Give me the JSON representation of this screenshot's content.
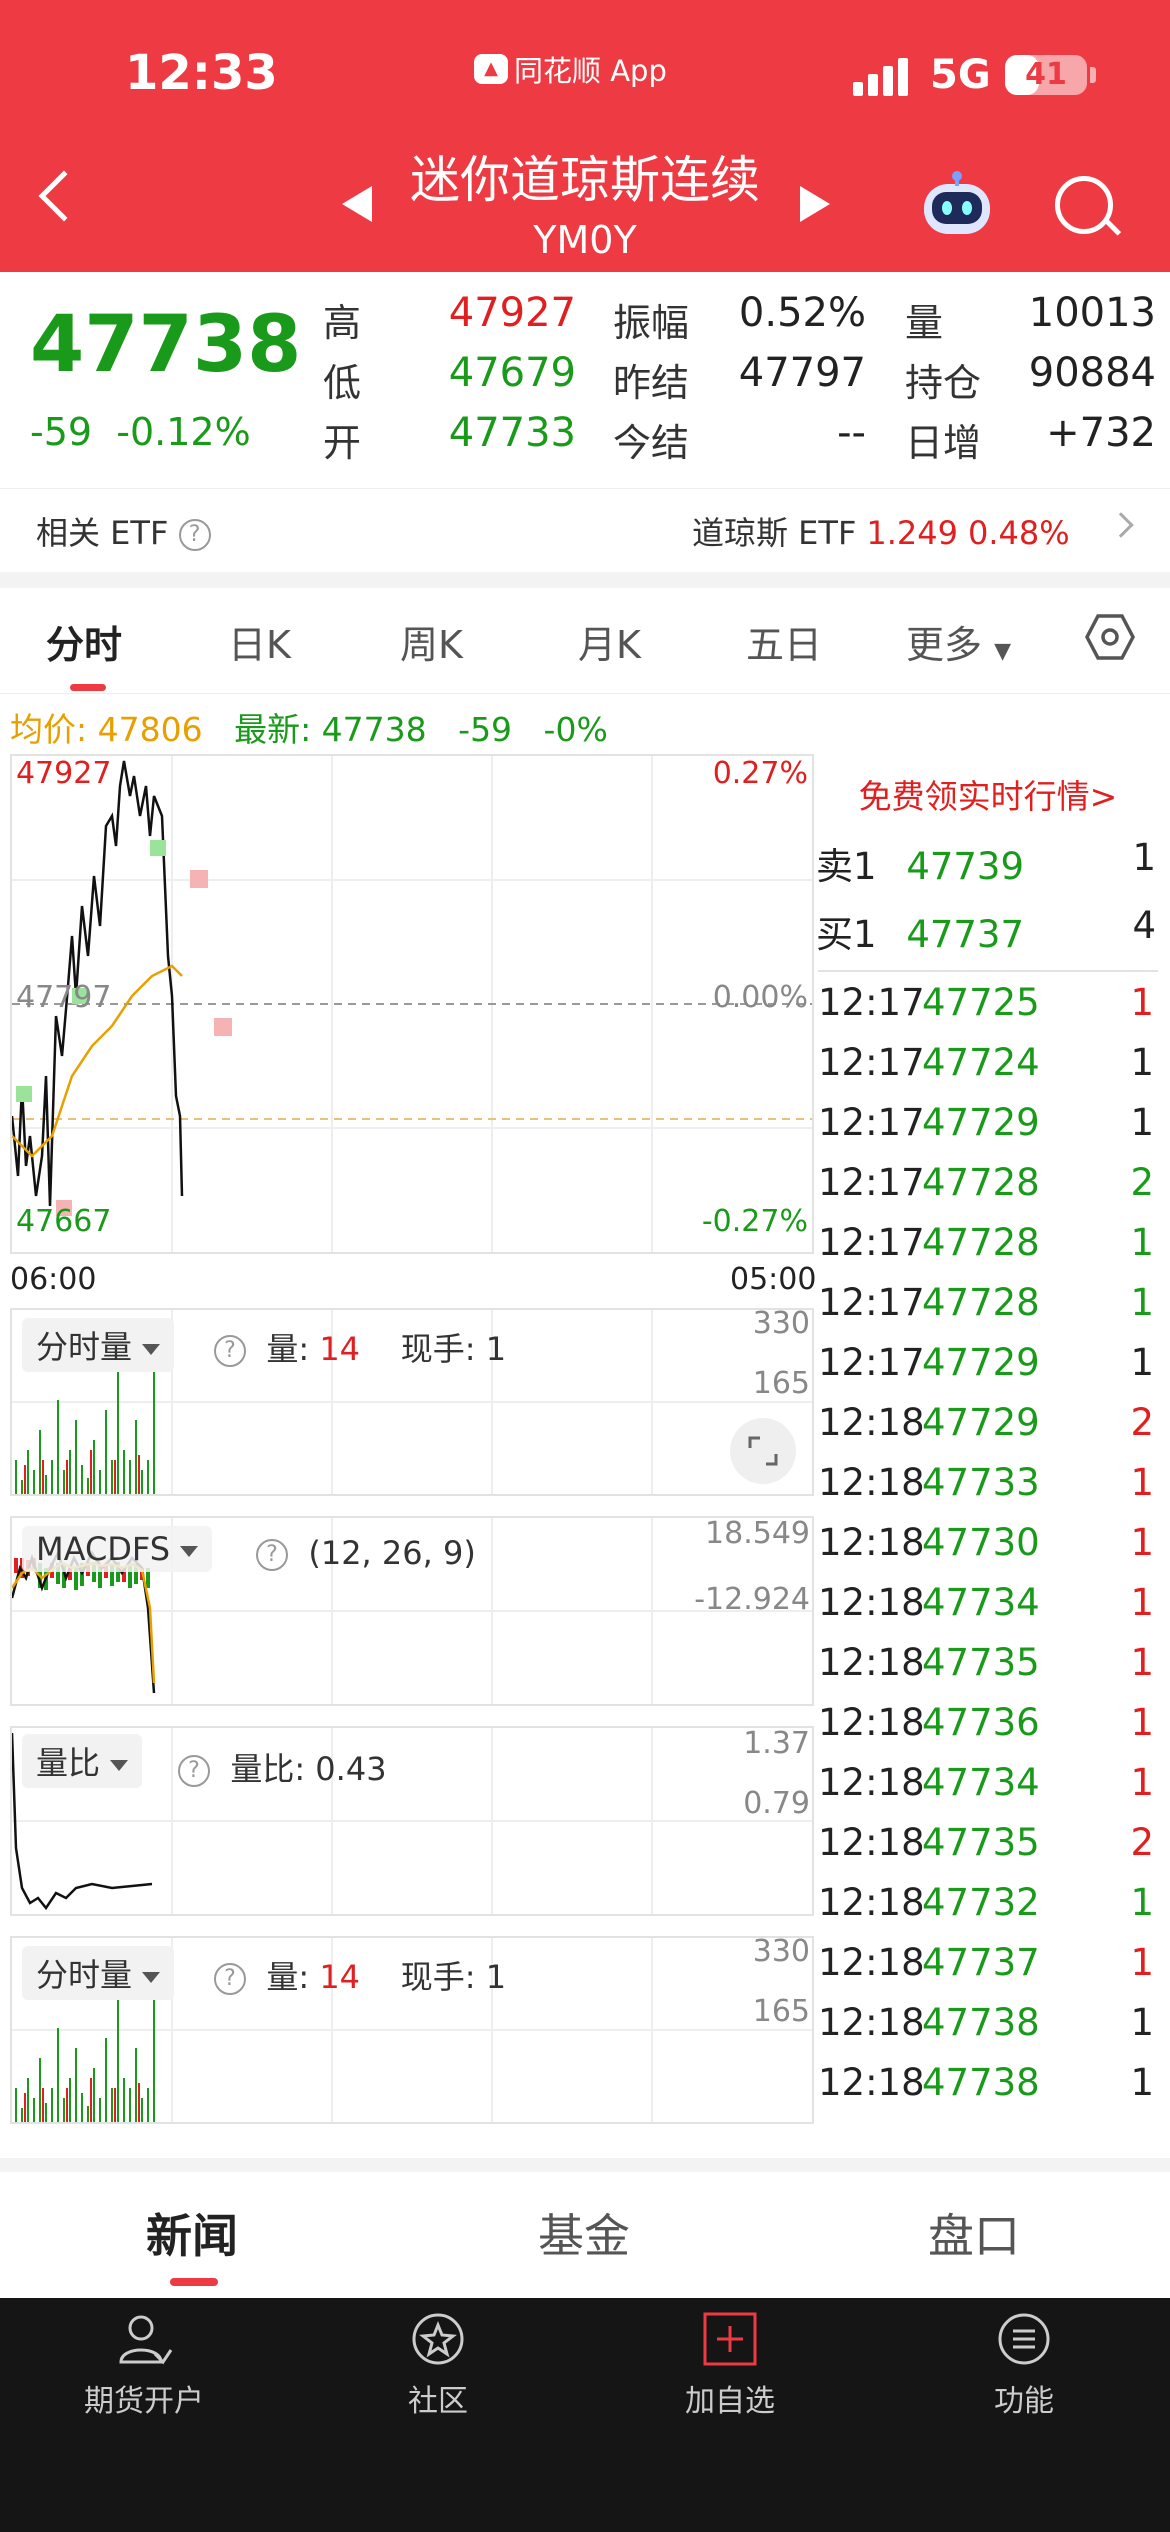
{
  "status_bar": {
    "time": "12:33",
    "app_name": "同花顺 App",
    "network": "5G",
    "battery": "41",
    "battery_level": 0.41
  },
  "header": {
    "title": "迷你道琼斯连续",
    "symbol": "YM0Y"
  },
  "quote": {
    "last_price": "47738",
    "change": "-59",
    "change_pct": "-0.12%",
    "high_label": "高",
    "high": "47927",
    "low_label": "低",
    "low": "47679",
    "open_label": "开",
    "open": "47733",
    "amplitude_label": "振幅",
    "amplitude": "0.52%",
    "prev_settle_label": "昨结",
    "prev_settle": "47797",
    "today_settle_label": "今结",
    "today_settle": "--",
    "volume_label": "量",
    "volume": "10013",
    "open_interest_label": "持仓",
    "open_interest": "90884",
    "daily_change_label": "日增",
    "daily_change": "+732"
  },
  "etf": {
    "label": "相关 ETF",
    "name": "道琼斯 ETF",
    "price": "1.249",
    "pct": "0.48%"
  },
  "tabs": [
    "分时",
    "日K",
    "周K",
    "月K",
    "五日",
    "更多"
  ],
  "intraday": {
    "avg_label": "均价: 47806",
    "latest_label": "最新: 47738",
    "latest_change": "-59",
    "latest_pct": "-0%",
    "y_top": "47927",
    "y_mid": "47797",
    "y_bottom": "47667",
    "pct_top": "0.27%",
    "pct_mid": "0.00%",
    "pct_bottom": "-0.27%",
    "x_start": "06:00",
    "x_end": "05:00"
  },
  "order_book": {
    "promo": "免费领实时行情>",
    "sell1_label": "卖1",
    "sell1_price": "47739",
    "sell1_vol": "1",
    "buy1_label": "买1",
    "buy1_price": "47737",
    "buy1_vol": "4"
  },
  "trades": [
    {
      "t": "12:17",
      "p": "47725",
      "v": "1",
      "c": "red"
    },
    {
      "t": "12:17",
      "p": "47724",
      "v": "1",
      "c": "dark"
    },
    {
      "t": "12:17",
      "p": "47729",
      "v": "1",
      "c": "dark"
    },
    {
      "t": "12:17",
      "p": "47728",
      "v": "2",
      "c": "green"
    },
    {
      "t": "12:17",
      "p": "47728",
      "v": "1",
      "c": "green"
    },
    {
      "t": "12:17",
      "p": "47728",
      "v": "1",
      "c": "green"
    },
    {
      "t": "12:17",
      "p": "47729",
      "v": "1",
      "c": "dark"
    },
    {
      "t": "12:18",
      "p": "47729",
      "v": "2",
      "c": "red"
    },
    {
      "t": "12:18",
      "p": "47733",
      "v": "1",
      "c": "red"
    },
    {
      "t": "12:18",
      "p": "47730",
      "v": "1",
      "c": "red"
    },
    {
      "t": "12:18",
      "p": "47734",
      "v": "1",
      "c": "red"
    },
    {
      "t": "12:18",
      "p": "47735",
      "v": "1",
      "c": "red"
    },
    {
      "t": "12:18",
      "p": "47736",
      "v": "1",
      "c": "red"
    },
    {
      "t": "12:18",
      "p": "47734",
      "v": "1",
      "c": "red"
    },
    {
      "t": "12:18",
      "p": "47735",
      "v": "2",
      "c": "red"
    },
    {
      "t": "12:18",
      "p": "47732",
      "v": "1",
      "c": "green"
    },
    {
      "t": "12:18",
      "p": "47737",
      "v": "1",
      "c": "red"
    },
    {
      "t": "12:18",
      "p": "47738",
      "v": "1",
      "c": "dark"
    },
    {
      "t": "12:18",
      "p": "47738",
      "v": "1",
      "c": "dark"
    }
  ],
  "vol_panel": {
    "selector": "分时量",
    "vol_label": "量:",
    "vol_value": "14",
    "hand_label": "现手:",
    "hand_value": "1",
    "axis_top": "330",
    "axis_mid": "165"
  },
  "macd_panel": {
    "selector": "MACDFS",
    "params": "(12, 26, 9)",
    "axis_top": "18.549",
    "axis_mid": "-12.924"
  },
  "ratio_panel": {
    "selector": "量比",
    "label": "量比: 0.43",
    "axis_top": "1.37",
    "axis_mid": "0.79"
  },
  "vol_panel2": {
    "selector": "分时量",
    "vol_label": "量:",
    "vol_value": "14",
    "hand_label": "现手:",
    "hand_value": "1",
    "axis_top": "330",
    "axis_mid": "165"
  },
  "bottom_tabs": [
    "新闻",
    "基金",
    "盘口"
  ],
  "nav": [
    {
      "label": "期货开户",
      "icon": "user-account-icon"
    },
    {
      "label": "社区",
      "icon": "community-star-icon"
    },
    {
      "label": "加自选",
      "icon": "add-watchlist-icon"
    },
    {
      "label": "功能",
      "icon": "menu-icon"
    }
  ],
  "colors": {
    "brand_red": "#ee3a42",
    "up": "#e02020",
    "down": "#1a9a1a",
    "avg_line": "#e8a000"
  }
}
